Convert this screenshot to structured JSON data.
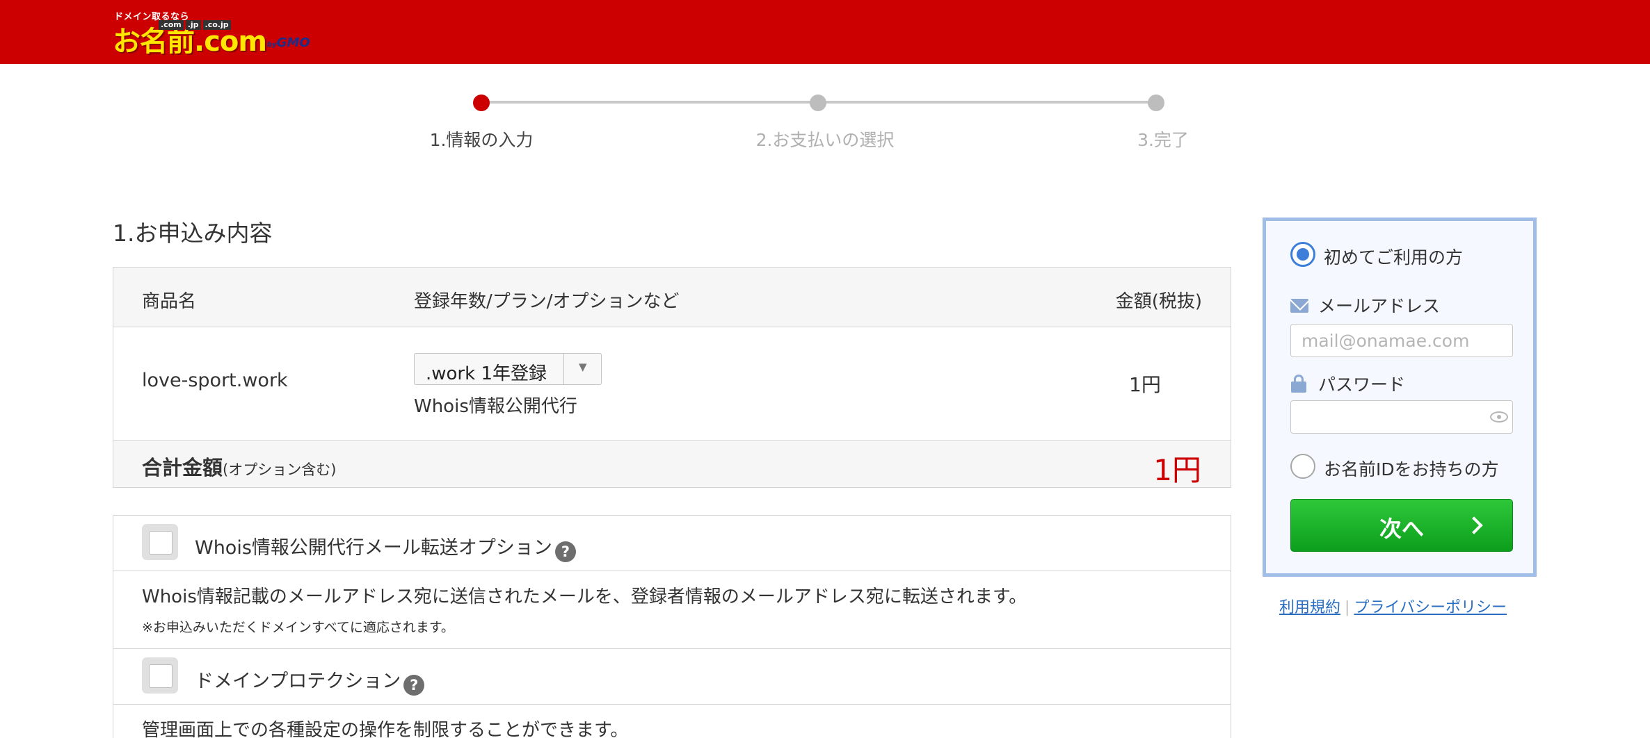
{
  "header": {
    "logo_tagline": "ドメイン取るなら",
    "logo_wordmark": "お名前.com",
    "logo_tlds": [
      ".com",
      ".jp",
      ".co.jp"
    ],
    "logo_gmo_prefix": "by",
    "logo_gmo": "GMO",
    "colors": {
      "header_bg": "#cc0000",
      "logo_yellow": "#ffe600"
    }
  },
  "stepper": {
    "steps": [
      {
        "label": "1.情報の入力",
        "state": "active"
      },
      {
        "label": "2.お支払いの選択",
        "state": "inactive"
      },
      {
        "label": "3.完了",
        "state": "inactive"
      }
    ]
  },
  "order": {
    "section_title": "1.お申込み内容",
    "columns": [
      "商品名",
      "登録年数/プラン/オプションなど",
      "金額(税抜)"
    ],
    "rows": [
      {
        "product": "love-sport.work",
        "plan_selected": ".work 1年登録",
        "option": "Whois情報公開代行",
        "price": "1円"
      }
    ],
    "total_label": "合計金額",
    "total_note": "(オプション含む)",
    "total_price": "1円"
  },
  "options": [
    {
      "title": "Whois情報公開代行メール転送オプション",
      "checked": false,
      "description": "Whois情報記載のメールアドレス宛に送信されたメールを、登録者情報のメールアドレス宛に転送されます。",
      "note": "※お申込みいただくドメインすべてに適応されます。"
    },
    {
      "title": "ドメインプロテクション",
      "checked": false,
      "description": "管理画面上での各種設定の操作を制限することができます。"
    }
  ],
  "login": {
    "first_time_label": "初めてご利用の方",
    "first_time_selected": true,
    "email_label": "メールアドレス",
    "email_placeholder": "mail@onamae.com",
    "email_value": "",
    "password_label": "パスワード",
    "password_value": "",
    "existing_label": "お名前IDをお持ちの方",
    "existing_selected": false,
    "next_button": "次へ",
    "icons": [
      "mail-icon",
      "lock-icon",
      "eye-icon",
      "chevron-right-icon",
      "help-icon"
    ],
    "colors": {
      "panel_border": "#9fbde6",
      "button_green": "#13a823",
      "radio_blue": "#3d7fd8"
    }
  },
  "footer": {
    "terms": "利用規約",
    "divider": "|",
    "privacy": "プライバシーポリシー"
  },
  "help_glyph": "?"
}
